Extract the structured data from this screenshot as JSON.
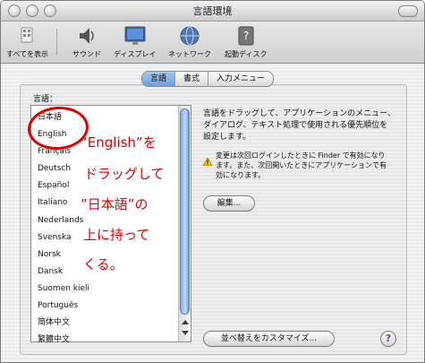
{
  "window": {
    "title": "言語環境"
  },
  "toolbar": {
    "items": [
      {
        "label": "すべてを表示",
        "icon": "show-all-icon"
      },
      {
        "label": "サウンド",
        "icon": "speaker-icon"
      },
      {
        "label": "ディスプレイ",
        "icon": "display-icon"
      },
      {
        "label": "ネットワーク",
        "icon": "globe-icon"
      },
      {
        "label": "起動ディスク",
        "icon": "disk-icon"
      }
    ]
  },
  "tabs": [
    {
      "label": "言語",
      "selected": true
    },
    {
      "label": "書式",
      "selected": false
    },
    {
      "label": "入力メニュー",
      "selected": false
    }
  ],
  "languages": {
    "label": "言語：",
    "items": [
      "日本語",
      "English",
      "Français",
      "Deutsch",
      "Español",
      "Italiano",
      "Nederlands",
      "Svenska",
      "Norsk",
      "Dansk",
      "Suomen kieli",
      "Português",
      "简体中文",
      "繁體中文"
    ]
  },
  "description": "言語をドラッグして、アプリケーションのメニュー、ダイアログ、テキスト処理で使用される優先順位を設定します。",
  "warning": "変更は次回ログインしたときに Finder で有効になります。また、次回開いたときにアプリケーションで有効になります。",
  "buttons": {
    "edit": "編集...",
    "customize_sort": "並べ替えをカスタマイズ...",
    "help": "?"
  },
  "annotation": {
    "lines": [
      "“English”を",
      "ドラッグして",
      "”日本語”の",
      "上に持って",
      "くる。"
    ],
    "color": "#e00000"
  }
}
